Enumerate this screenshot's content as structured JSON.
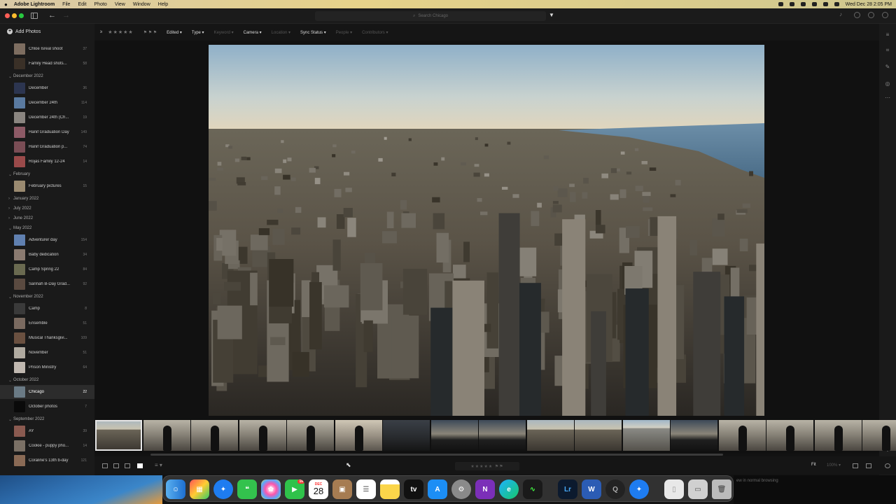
{
  "menubar": {
    "app": "Adobe Lightroom",
    "menus": [
      "File",
      "Edit",
      "Photo",
      "View",
      "Window",
      "Help"
    ],
    "datetime": "Wed Dec 28  2:05 PM"
  },
  "titlebar": {
    "search_placeholder": "Search Chicago"
  },
  "sidebar": {
    "add_photos": "Add Photos",
    "rows": [
      {
        "kind": "album",
        "label": "Chloe Isreal shoot",
        "count": "37",
        "thumb": "#7d6d60"
      },
      {
        "kind": "album",
        "label": "Family Head shots...",
        "count": "58",
        "thumb": "#3a3027"
      },
      {
        "kind": "folder",
        "label": "December 2022",
        "open": true
      },
      {
        "kind": "album",
        "label": "December",
        "count": "36",
        "thumb": "#2c3550"
      },
      {
        "kind": "album",
        "label": "December 24th",
        "count": "114",
        "thumb": "#5a7aa0"
      },
      {
        "kind": "album",
        "label": "December 24th (Ch...",
        "count": "19",
        "thumb": "#8a8580"
      },
      {
        "kind": "album",
        "label": "Hanif Graduation Day",
        "count": "149",
        "thumb": "#8d5a66"
      },
      {
        "kind": "album",
        "label": "Hanif Graduation p...",
        "count": "74",
        "thumb": "#7a4d55"
      },
      {
        "kind": "album",
        "label": "Rojas Family 12-24",
        "count": "14",
        "thumb": "#9a4a4a"
      },
      {
        "kind": "folder",
        "label": "February",
        "open": true
      },
      {
        "kind": "album",
        "label": "February pictures",
        "count": "15",
        "thumb": "#9a8a70"
      },
      {
        "kind": "folder",
        "label": "January 2022",
        "open": false
      },
      {
        "kind": "folder",
        "label": "July 2022",
        "open": false
      },
      {
        "kind": "folder",
        "label": "June 2022",
        "open": false
      },
      {
        "kind": "folder",
        "label": "May 2022",
        "open": true
      },
      {
        "kind": "album",
        "label": "Adventurer day",
        "count": "154",
        "thumb": "#6080b0"
      },
      {
        "kind": "album",
        "label": "Baby dedication",
        "count": "34",
        "thumb": "#8a7a70"
      },
      {
        "kind": "album",
        "label": "Camp Spring 22",
        "count": "84",
        "thumb": "#6a6a50"
      },
      {
        "kind": "album",
        "label": "Sarinah B-Day Grad...",
        "count": "92",
        "thumb": "#5a4a40"
      },
      {
        "kind": "folder",
        "label": "November 2022",
        "open": true
      },
      {
        "kind": "album",
        "label": "Camp",
        "count": "8",
        "thumb": "#3a3a3a"
      },
      {
        "kind": "album",
        "label": "Ensemble",
        "count": "51",
        "thumb": "#7a6a60"
      },
      {
        "kind": "album",
        "label": "Musical Thanksgivi...",
        "count": "109",
        "thumb": "#6a5040"
      },
      {
        "kind": "album",
        "label": "November",
        "count": "51",
        "thumb": "#b0aaa0"
      },
      {
        "kind": "album",
        "label": "Prison Ministry",
        "count": "64",
        "thumb": "#c0b8b0"
      },
      {
        "kind": "folder",
        "label": "October 2022",
        "open": true
      },
      {
        "kind": "album",
        "label": "Chicago",
        "count": "22",
        "thumb": "#6a7a85",
        "selected": true
      },
      {
        "kind": "album",
        "label": "October photos",
        "count": "7",
        "thumb": "#0a0a0a"
      },
      {
        "kind": "folder",
        "label": "September 2022",
        "open": true
      },
      {
        "kind": "album",
        "label": "AY",
        "count": "39",
        "thumb": "#8a5a50"
      },
      {
        "kind": "album",
        "label": "Cookie - puppy pho...",
        "count": "14",
        "thumb": "#7a7065"
      },
      {
        "kind": "album",
        "label": "Coraline's 13th b-day",
        "count": "121",
        "thumb": "#8a6a55"
      }
    ]
  },
  "filterbar": {
    "rating_count": "≥",
    "filters": [
      {
        "label": "Edited",
        "active": true
      },
      {
        "label": "Type",
        "active": true
      },
      {
        "label": "Keyword",
        "active": false
      },
      {
        "label": "Camera",
        "active": true
      },
      {
        "label": "Location",
        "active": false
      },
      {
        "label": "Sync Status",
        "active": true
      },
      {
        "label": "People",
        "active": false
      },
      {
        "label": "Contributors",
        "active": false
      }
    ]
  },
  "filmstrip": {
    "thumbs": [
      {
        "kind": "city",
        "selected": true
      },
      {
        "kind": "person"
      },
      {
        "kind": "person"
      },
      {
        "kind": "person"
      },
      {
        "kind": "person"
      },
      {
        "kind": "person-light"
      },
      {
        "kind": "dark"
      },
      {
        "kind": "dusk"
      },
      {
        "kind": "dusk"
      },
      {
        "kind": "city"
      },
      {
        "kind": "city"
      },
      {
        "kind": "city-bright"
      },
      {
        "kind": "dusk"
      },
      {
        "kind": "person"
      },
      {
        "kind": "person"
      },
      {
        "kind": "person"
      },
      {
        "kind": "person"
      }
    ]
  },
  "bottombar": {
    "fit_label": "Fit",
    "zoom": "100%"
  },
  "dock": {
    "calendar_month": "DEC",
    "calendar_day": "28",
    "facetime_badge": "16",
    "lr_label": "Lr",
    "word_label": "W",
    "onenote_label": "N"
  },
  "desktop": {
    "notice": "ew in normal browsing"
  }
}
